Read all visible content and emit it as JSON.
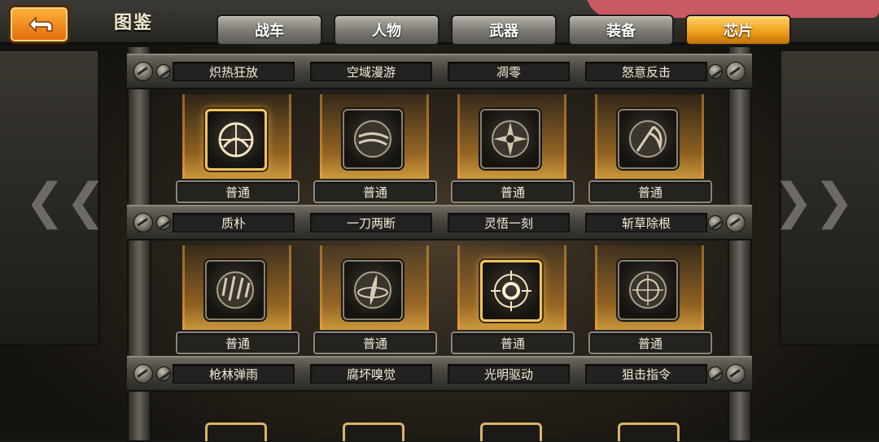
{
  "header": {
    "title": "图鉴",
    "tabs": [
      {
        "label": "战车",
        "active": false
      },
      {
        "label": "人物",
        "active": false
      },
      {
        "label": "武器",
        "active": false
      },
      {
        "label": "装备",
        "active": false
      },
      {
        "label": "芯片",
        "active": true
      }
    ]
  },
  "colors": {
    "accent_orange": "#f0a01c",
    "tab_gray": "#7b7872",
    "frame_gold": "#f2c45c"
  },
  "shelves": {
    "row0_names": [
      "炽热狂放",
      "空域漫游",
      "凋零",
      "怒意反击"
    ],
    "row1": [
      {
        "rarity": "普通",
        "icon": "crosshair-arc-icon",
        "highlight": true
      },
      {
        "rarity": "普通",
        "icon": "slash-orb-icon",
        "highlight": false
      },
      {
        "rarity": "普通",
        "icon": "shuriken-icon",
        "highlight": false
      },
      {
        "rarity": "普通",
        "icon": "scythe-icon",
        "highlight": false
      }
    ],
    "row1_names": [
      "质朴",
      "一刀两断",
      "灵悟一刻",
      "斩草除根"
    ],
    "row2": [
      {
        "rarity": "普通",
        "icon": "bullet-rain-icon",
        "highlight": false
      },
      {
        "rarity": "普通",
        "icon": "blade-ring-icon",
        "highlight": false
      },
      {
        "rarity": "普通",
        "icon": "target-burst-icon",
        "highlight": true
      },
      {
        "rarity": "普通",
        "icon": "scope-icon",
        "highlight": false
      }
    ],
    "row2_names": [
      "枪林弹雨",
      "腐坏嗅觉",
      "光明驱动",
      "狙击指令"
    ]
  }
}
